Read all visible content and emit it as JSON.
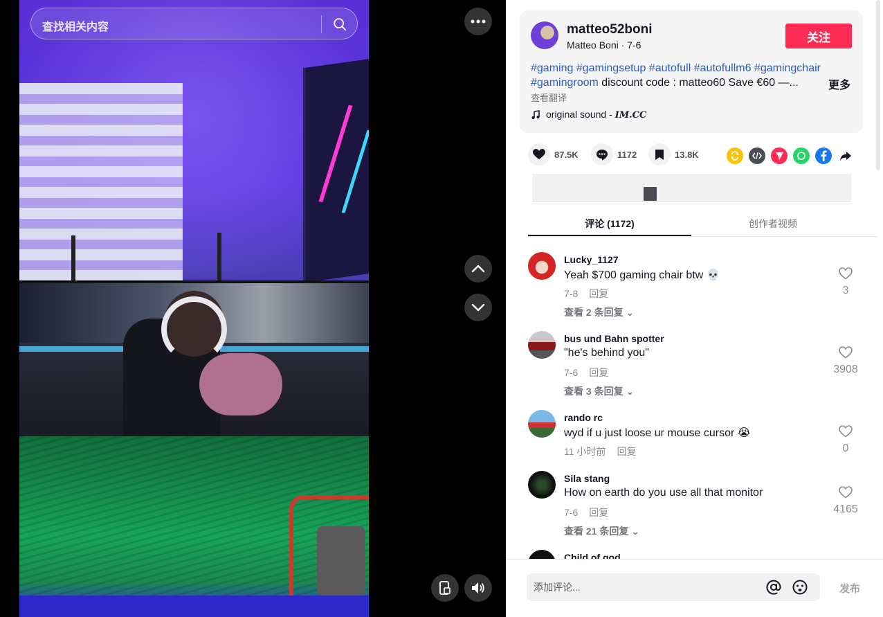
{
  "search": {
    "placeholder": "查找相关内容"
  },
  "author": {
    "username": "matteo52boni",
    "display_name": "Matteo Boni",
    "date": "7-6",
    "subtitle": "Matteo Boni · 7-6",
    "follow_label": "关注"
  },
  "description": {
    "line1_tags": [
      "#gaming",
      "#gamingsetup",
      "#autofull",
      "#autofullm6",
      "#gamingchair"
    ],
    "line2_tag": "#gamingroom",
    "line2_text": " discount code : matteo60 Save €60 —...",
    "more_label": "更多",
    "translate_label": "查看翻译"
  },
  "sound": {
    "prefix": "original sound - ",
    "brand": "IM.CC"
  },
  "actions": {
    "likes": "87.5K",
    "comments": "1172",
    "saves": "13.8K"
  },
  "share_icons": [
    "repost-icon",
    "embed-icon",
    "send-icon",
    "whatsapp-icon",
    "facebook-icon",
    "share-arrow-icon"
  ],
  "colors": {
    "accent": "#fe2c55",
    "tag": "#2b5db9"
  },
  "tabs": [
    {
      "label": "评论 (1172)",
      "active": true
    },
    {
      "label": "创作者视频",
      "active": false
    }
  ],
  "comments": [
    {
      "user": "Lucky_1127",
      "text": "Yeah $700 gaming chair btw 💀",
      "date": "7-8",
      "reply": "回复",
      "likes": "3",
      "more": "查看 2 条回复 ⌄"
    },
    {
      "user": "bus und Bahn spotter",
      "text": "\"he's behind you\"",
      "date": "7-6",
      "reply": "回复",
      "likes": "3908",
      "more": "查看 3 条回复 ⌄"
    },
    {
      "user": "rando rc",
      "text": "wyd if u just loose ur mouse cursor 😭",
      "date": "11 小时前",
      "reply": "回复",
      "likes": "0",
      "more": ""
    },
    {
      "user": "Sila stang",
      "text": "How on earth do you use all that monitor",
      "date": "7-6",
      "reply": "回复",
      "likes": "4165",
      "more": "查看 21 条回复 ⌄"
    },
    {
      "user": "Child of god",
      "text": "",
      "date": "",
      "reply": "",
      "likes": "",
      "more": ""
    }
  ],
  "input": {
    "placeholder": "添加评论...",
    "post_label": "发布"
  }
}
